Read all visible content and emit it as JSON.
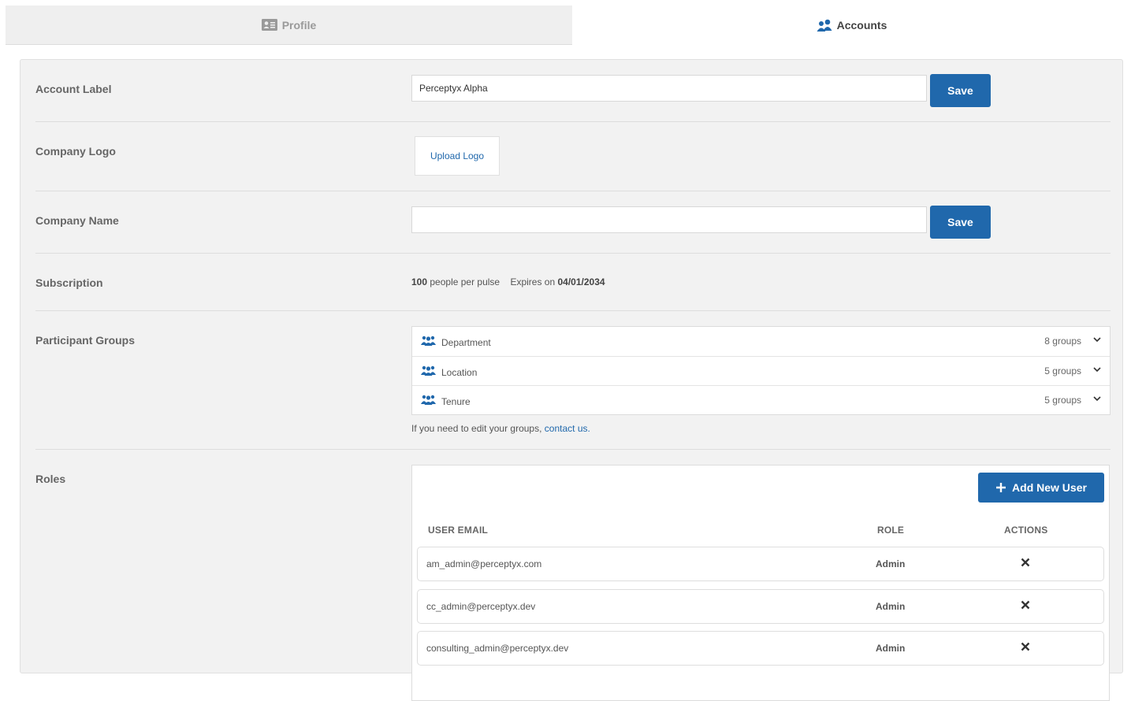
{
  "tabs": {
    "profile": {
      "label": "Profile",
      "icon": "id-card-icon"
    },
    "accounts": {
      "label": "Accounts",
      "icon": "users-icon"
    }
  },
  "account_label": {
    "label": "Account Label",
    "value": "Perceptyx Alpha",
    "save_label": "Save"
  },
  "company_logo": {
    "label": "Company Logo",
    "upload_label": "Upload Logo"
  },
  "company_name": {
    "label": "Company Name",
    "value": "",
    "save_label": "Save"
  },
  "subscription": {
    "label": "Subscription",
    "people_count": "100",
    "people_text": "people per pulse",
    "expires_text": "Expires on",
    "expires_date": "04/01/2034"
  },
  "participant_groups": {
    "label": "Participant Groups",
    "items": [
      {
        "name": "Department",
        "count": "8 groups"
      },
      {
        "name": "Location",
        "count": "5 groups"
      },
      {
        "name": "Tenure",
        "count": "5 groups"
      }
    ],
    "note": "If you need to edit your groups,",
    "note_link": "contact us."
  },
  "roles": {
    "label": "Roles",
    "add_user_label": "Add New User",
    "columns": {
      "email": "USER EMAIL",
      "role": "ROLE",
      "actions": "ACTIONS"
    },
    "users": [
      {
        "email": "am_admin@perceptyx.com",
        "role": "Admin"
      },
      {
        "email": "cc_admin@perceptyx.dev",
        "role": "Admin"
      },
      {
        "email": "consulting_admin@perceptyx.dev",
        "role": "Admin"
      }
    ]
  },
  "colors": {
    "primary": "#2068ac",
    "panel_bg": "#f2f2f2"
  }
}
